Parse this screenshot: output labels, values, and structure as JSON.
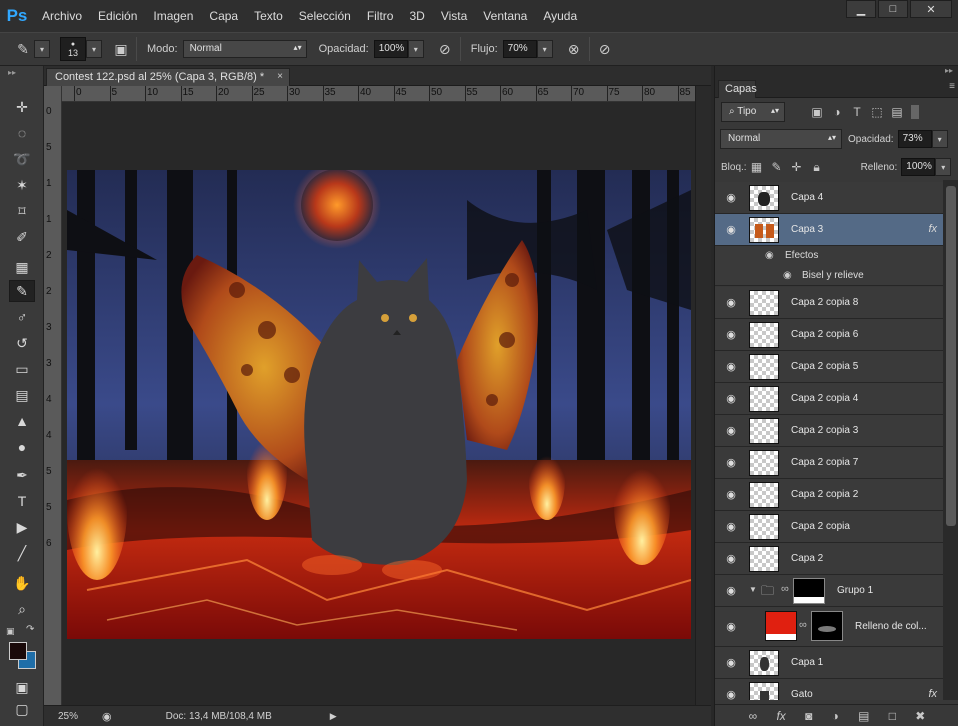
{
  "app": {
    "logo": "Ps"
  },
  "menu": [
    "Archivo",
    "Edición",
    "Imagen",
    "Capa",
    "Texto",
    "Selección",
    "Filtro",
    "3D",
    "Vista",
    "Ventana",
    "Ayuda"
  ],
  "window_controls": {
    "minimize": "▁",
    "maximize": "□",
    "close": "✕"
  },
  "options": {
    "brush_size": "13",
    "mode_label": "Modo:",
    "mode_value": "Normal",
    "opacity_label": "Opacidad:",
    "opacity_value": "100%",
    "flow_label": "Flujo:",
    "flow_value": "70%"
  },
  "document": {
    "tab_title": "Contest 122.psd al 25% (Capa 3, RGB/8) *",
    "tab_close": "×",
    "zoom": "25%",
    "doc_size": "Doc: 13,4 MB/108,4 MB",
    "ruler_top": [
      "0",
      "5",
      "10",
      "15",
      "20",
      "25",
      "30",
      "35",
      "40",
      "45",
      "50",
      "55",
      "60",
      "65",
      "70",
      "75",
      "80",
      "85"
    ],
    "ruler_left": [
      "0",
      "5",
      "1",
      "1",
      "2",
      "2",
      "3",
      "3",
      "4",
      "4",
      "5",
      "5",
      "6"
    ]
  },
  "layers_panel": {
    "tab": "Capas",
    "filter_kind": "Tipo",
    "blend_mode": "Normal",
    "opacity_label": "Opacidad:",
    "opacity_value": "73%",
    "lock_label": "Bloq.:",
    "fill_label": "Relleno:",
    "fill_value": "100%",
    "layers": [
      {
        "name": "Capa 4",
        "fx": ""
      },
      {
        "name": "Capa 3",
        "fx": "fx",
        "selected": true
      },
      {
        "name": "Capa 2 copia 8",
        "fx": ""
      },
      {
        "name": "Capa 2 copia 6",
        "fx": ""
      },
      {
        "name": "Capa 2 copia 5",
        "fx": ""
      },
      {
        "name": "Capa 2 copia 4",
        "fx": ""
      },
      {
        "name": "Capa 2 copia 3",
        "fx": ""
      },
      {
        "name": "Capa 2 copia 7",
        "fx": ""
      },
      {
        "name": "Capa 2 copia 2",
        "fx": ""
      },
      {
        "name": "Capa 2 copia",
        "fx": ""
      },
      {
        "name": "Capa 2",
        "fx": ""
      },
      {
        "name": "Grupo 1",
        "fx": ""
      },
      {
        "name": "Relleno de col...",
        "fx": ""
      },
      {
        "name": "Capa 1",
        "fx": ""
      },
      {
        "name": "Gato",
        "fx": "fx"
      }
    ],
    "effects_label": "Efectos",
    "effect_item": "Bisel y relieve"
  },
  "colors": {
    "foreground": "#1a0a0a",
    "background": "#1f6ea8",
    "selection": "#546a86"
  }
}
